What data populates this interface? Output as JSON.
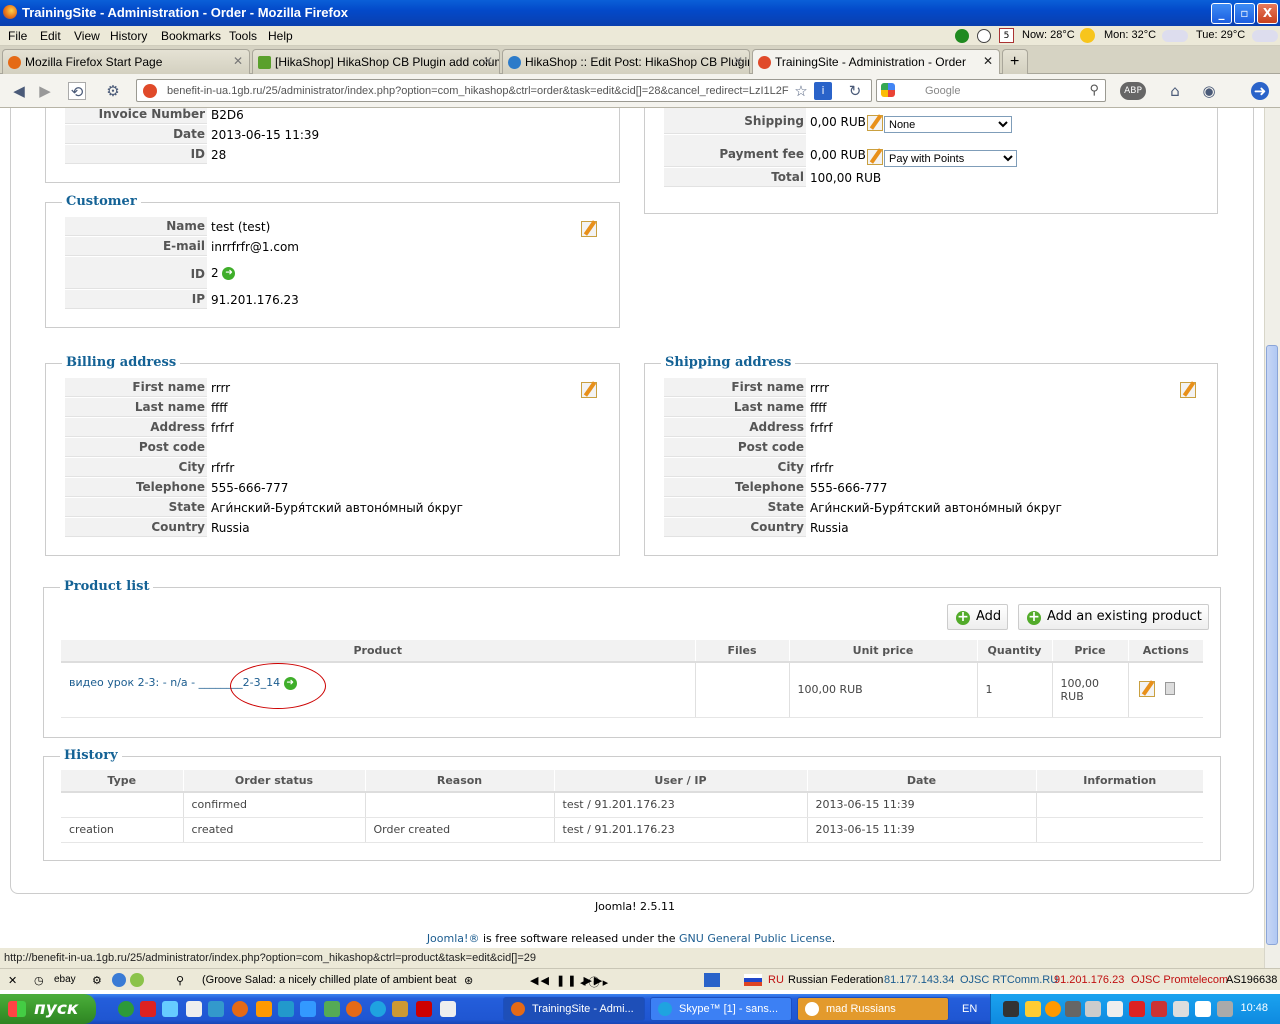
{
  "window": {
    "title": "TrainingSite - Administration - Order - Mozilla Firefox",
    "min": "_",
    "max": "▫",
    "close": "X"
  },
  "menu": [
    "File",
    "Edit",
    "View",
    "History",
    "Bookmarks",
    "Tools",
    "Help"
  ],
  "weather": {
    "now": "Now: 28°C",
    "mon": "Mon: 32°C",
    "tue": "Tue: 29°C",
    "calendar": "5"
  },
  "tabs": [
    {
      "label": "Mozilla Firefox Start Page"
    },
    {
      "label": "[HikaShop] HikaShop CB Plugin add colum..."
    },
    {
      "label": "HikaShop :: Edit Post: HikaShop CB Plugin..."
    },
    {
      "label": "TrainingSite - Administration - Order"
    }
  ],
  "url": "benefit-in-ua.1gb.ru/25/administrator/index.php?option=com_hikashop&ctrl=order&task=edit&cid[]=28&cancel_redirect=LzI1L2F",
  "search_placeholder": "Google",
  "order_info": {
    "invoice_label": "Invoice Number",
    "invoice": "B2D6",
    "date_label": "Date",
    "date": "2013-06-15 11:39",
    "id_label": "ID",
    "id": "28"
  },
  "totals": {
    "shipping_label": "Shipping",
    "shipping": "0,00 RUB",
    "shipping_method": "None",
    "payment_label": "Payment fee",
    "payment": "0,00 RUB",
    "payment_method": "Pay with Points",
    "total_label": "Total",
    "total": "100,00 RUB"
  },
  "customer": {
    "legend": "Customer",
    "name_label": "Name",
    "name": "test (test)",
    "email_label": "E-mail",
    "email": "inrrfrfr@1.com",
    "id_label": "ID",
    "id": "2",
    "ip_label": "IP",
    "ip": "91.201.176.23"
  },
  "billing": {
    "legend": "Billing address",
    "first_label": "First name",
    "first": "rrrr",
    "last_label": "Last name",
    "last": "ffff",
    "address_label": "Address",
    "address": "frfrf",
    "post_label": "Post code",
    "post": "",
    "city_label": "City",
    "city": "rfrfr",
    "tel_label": "Telephone",
    "tel": "555-666-777",
    "state_label": "State",
    "state": "Аги́нский-Буря́тский автоно́мный о́круг",
    "country_label": "Country",
    "country": "Russia"
  },
  "shipping_addr": {
    "legend": "Shipping address",
    "first_label": "First name",
    "first": "rrrr",
    "last_label": "Last name",
    "last": "ffff",
    "address_label": "Address",
    "address": "frfrf",
    "post_label": "Post code",
    "post": "",
    "city_label": "City",
    "city": "rfrfr",
    "tel_label": "Telephone",
    "tel": "555-666-777",
    "state_label": "State",
    "state": "Аги́нский-Буря́тский автоно́мный о́круг",
    "country_label": "Country",
    "country": "Russia"
  },
  "products": {
    "legend": "Product list",
    "add": "Add",
    "add_existing": "Add an existing product",
    "headers": [
      "Product",
      "Files",
      "Unit price",
      "Quantity",
      "Price",
      "Actions"
    ],
    "row": {
      "name": "видео урок 2-3: - n/a - ________",
      "code": "2-3_14",
      "files": "",
      "unit": "100,00 RUB",
      "qty": "1",
      "price": "100,00 RUB"
    }
  },
  "history": {
    "legend": "History",
    "headers": [
      "Type",
      "Order status",
      "Reason",
      "User / IP",
      "Date",
      "Information"
    ],
    "rows": [
      {
        "type": "",
        "status": "confirmed",
        "reason": "",
        "user": "test / 91.201.176.23",
        "date": "2013-06-15 11:39",
        "info": ""
      },
      {
        "type": "creation",
        "status": "created",
        "reason": "Order created",
        "user": "test / 91.201.176.23",
        "date": "2013-06-15 11:39",
        "info": ""
      }
    ]
  },
  "footer": {
    "version": "Joomla! 2.5.11",
    "joomla": "Joomla!®",
    "text": " is free software released under the ",
    "license": "GNU General Public License",
    "dot": "."
  },
  "status_url": "http://benefit-in-ua.1gb.ru/25/administrator/index.php?option=com_hikashop&ctrl=product&task=edit&cid[]=29",
  "addon": {
    "ebay": "ebay",
    "radio": "(Groove Salad: a nicely chilled plate of ambient beat",
    "lang": "RU",
    "country": "Russian Federation",
    "ip1": "81.177.143.34",
    "isp1": "OJSC RTComm.RU",
    "ip2": "91.201.176.23",
    "isp2": "OJSC Promtelecom",
    "as": "AS196638"
  },
  "taskbar": {
    "start": "пуск",
    "t1": "TrainingSite - Admi...",
    "t2": "Skype™ [1] - sans...",
    "t3": "mad Russians",
    "lang": "EN",
    "clock": "10:48"
  }
}
